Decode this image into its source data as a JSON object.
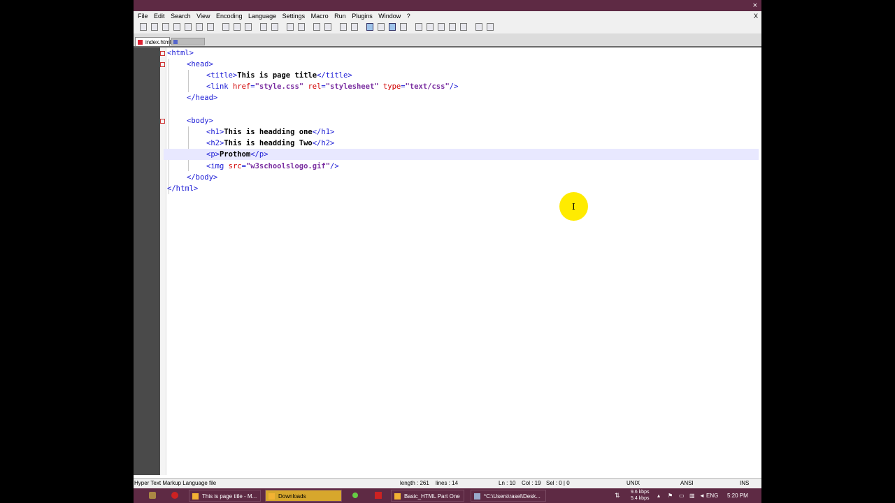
{
  "window": {
    "close": "×"
  },
  "menu": [
    "File",
    "Edit",
    "Search",
    "View",
    "Encoding",
    "Language",
    "Settings",
    "Macro",
    "Run",
    "Plugins",
    "Window",
    "?"
  ],
  "menu_close": "X",
  "tabs": {
    "active": "index.html"
  },
  "code": {
    "l1": "<html>",
    "l2": "<head>",
    "l3_open": "<title>",
    "l3_text": "This is page title",
    "l3_close": "</title>",
    "l4_tag": "<link",
    "l4_a1": "href",
    "l4_v1": "\"style.css\"",
    "l4_a2": "rel",
    "l4_v2": "\"stylesheet\"",
    "l4_a3": "type",
    "l4_v3": "\"text/css\"",
    "l4_end": "/>",
    "l5": "</head>",
    "l7": "<body>",
    "l8_open": "<h1>",
    "l8_text": "This is headding one",
    "l8_close": "</h1>",
    "l9_open": "<h2>",
    "l9_text": "This is headding Two",
    "l9_close": "</h2>",
    "l10_open": "<p>",
    "l10_text": "Prothom",
    "l10_close": "</p>",
    "l11_tag": "<img",
    "l11_a1": "src",
    "l11_v1": "\"w3schoolslogo.gif\"",
    "l11_end": "/>",
    "l12": "</body>",
    "l13": "</html>"
  },
  "cursor_glyph": "I",
  "status": {
    "filetype": "Hyper Text Markup Language file",
    "length": "length : 261",
    "lines": "lines : 14",
    "ln": "Ln : 10",
    "col": "Col : 19",
    "sel": "Sel : 0 | 0",
    "eol": "UNIX",
    "encoding": "ANSI",
    "mode": "INS"
  },
  "taskbar": {
    "items": [
      "This is page title - M...",
      "Downloads",
      "Basic_HTML Part One",
      "*C:\\Users\\rasel\\Desk..."
    ],
    "speed_up": "9.6 kbps",
    "speed_down": "5.4 kbps",
    "lang": "ENG",
    "time": "5:20 PM"
  }
}
